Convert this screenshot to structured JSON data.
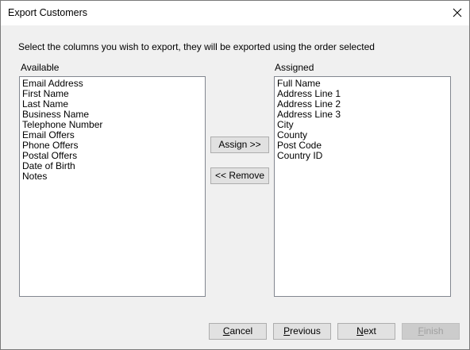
{
  "window": {
    "title": "Export Customers"
  },
  "instructions": "Select the columns you wish to export, they will be exported using the order selected",
  "available": {
    "label": "Available",
    "items": [
      "Email Address",
      "First Name",
      "Last Name",
      "Business Name",
      "Telephone Number",
      "Email Offers",
      "Phone Offers",
      "Postal Offers",
      "Date of Birth",
      "Notes"
    ]
  },
  "assigned": {
    "label": "Assigned",
    "items": [
      "Full Name",
      "Address Line 1",
      "Address Line 2",
      "Address Line 3",
      "City",
      "County",
      "Post Code",
      "Country ID"
    ]
  },
  "buttons": {
    "assign": "Assign >>",
    "remove": "<< Remove",
    "cancel": {
      "mnemonic": "C",
      "rest": "ancel"
    },
    "previous": {
      "mnemonic": "P",
      "rest": "revious"
    },
    "next": {
      "mnemonic": "N",
      "rest": "ext"
    },
    "finish": {
      "mnemonic": "F",
      "rest": "inish",
      "disabled": true
    }
  },
  "icons": {
    "close": "close-icon"
  }
}
